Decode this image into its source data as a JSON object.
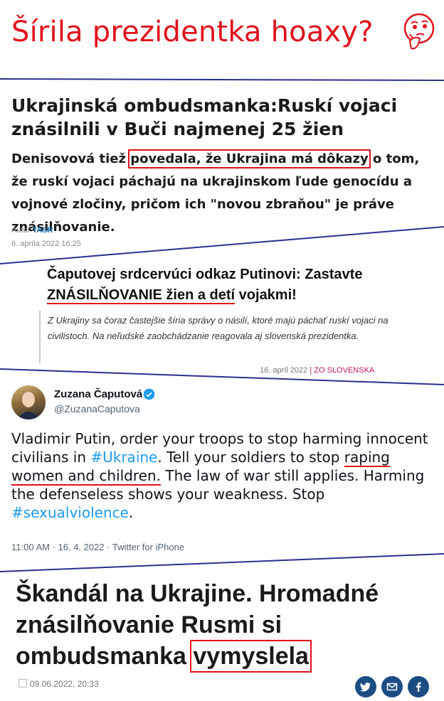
{
  "header": {
    "title": "Šírila prezidentka hoaxy?",
    "emoji_icon": "thinking-face-icon"
  },
  "section1": {
    "headline": "Ukrajinská ombudsmanka:Ruskí vojaci znásilnili v Buči najmenej 25 žien",
    "lead_before": "Denisovová tiež ",
    "lead_highlight": "povedala, že Ukrajina má dôkazy",
    "lead_after": " o tom, že ruskí vojaci páchajú na ukrajinskom ľude genocídu a vojnové zločiny, pričom ich \"novou zbraňou\" je práve znásilňovanie.",
    "author_label": "Autor",
    "author": "TASR",
    "date": "6. apríla 2022 16:25"
  },
  "section2": {
    "headline_before": "Čaputovej srdcervúci odkaz Putinovi: Zastavte ",
    "headline_underlined": "ZNÁSILŇOVANIE žien a detí",
    "headline_after": " vojakmi!",
    "quote": "Z Ukrajiny sa čoraz častejšie šíria správy o násilí, ktoré majú páchať ruskí vojaci na civilistoch. Na neľudské zaobchádzanie reagovala aj slovenská prezidentka.",
    "date": "16. apríl 2022",
    "separator": "|",
    "source": "Zo Slovenska"
  },
  "section3": {
    "name": "Zuzana Čaputová",
    "handle": "@ZuzanaCaputova",
    "text_1": "Vladimir Putin, order your troops to stop harming innocent civilians in ",
    "hashtag_1": "#Ukraine",
    "text_2": ". Tell your soldiers to stop ",
    "underlined": "raping women and children.",
    "text_3": " The law of war still applies. Harming the defenseless shows your weakness. Stop ",
    "hashtag_2": "#sexualviolence",
    "text_4": ".",
    "meta": "11:00 AM · 16. 4. 2022 · Twitter for iPhone",
    "verified_icon": "verified-badge-icon"
  },
  "section4": {
    "headline": "Škandál na Ukrajine. Hromadné znásilňovanie Rusmi si ombudsmanka ",
    "headline_boxed": "vymyslela",
    "date": "09.06.2022, 20:33",
    "social": [
      "twitter-icon",
      "mail-icon",
      "facebook-icon"
    ]
  },
  "colors": {
    "accent_red": "#e0101b",
    "divider_blue": "#2b2f8f",
    "link_blue": "#1b75bb",
    "twitter_blue": "#1d9bf0",
    "social_navy": "#1b4d83"
  }
}
